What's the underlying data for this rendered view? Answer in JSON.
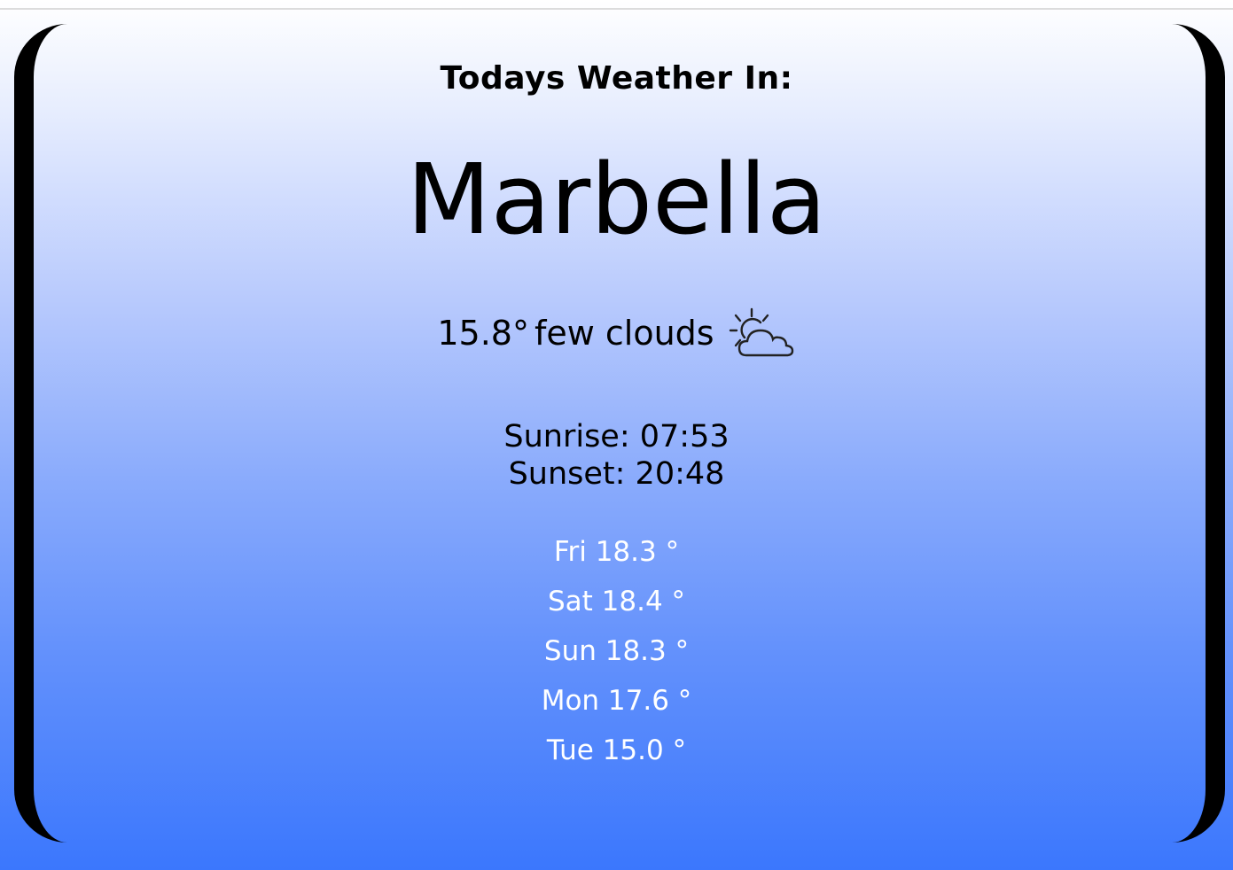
{
  "header": {
    "label": "Todays Weather In:",
    "city": "Marbella"
  },
  "current": {
    "temperature": "15.8°",
    "description": "few clouds",
    "icon": "partly-cloudy-icon"
  },
  "sun": {
    "sunrise": "Sunrise: 07:53",
    "sunset": "Sunset: 20:48"
  },
  "forecast": [
    {
      "text": "Fri 18.3 °"
    },
    {
      "text": "Sat 18.4 °"
    },
    {
      "text": "Sun 18.3 °"
    },
    {
      "text": "Mon 17.6 °"
    },
    {
      "text": "Tue 15.0 °"
    }
  ],
  "colors": {
    "gradient_top": "#ffffff",
    "gradient_bottom": "#3b77fd",
    "border": "#000000",
    "forecast_text": "#ffffff"
  }
}
